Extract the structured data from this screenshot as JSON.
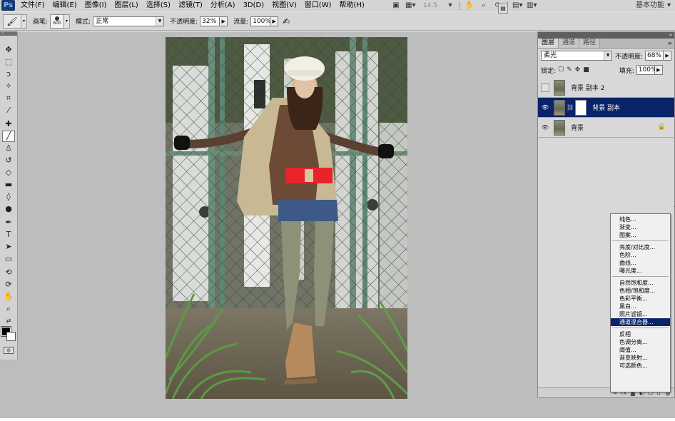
{
  "app": {
    "logo": "Ps",
    "workspace": "基本功能"
  },
  "menus": [
    {
      "label": "文件(F)"
    },
    {
      "label": "编辑(E)"
    },
    {
      "label": "图像(I)"
    },
    {
      "label": "图层(L)"
    },
    {
      "label": "选择(S)"
    },
    {
      "label": "滤镜(T)"
    },
    {
      "label": "分析(A)"
    },
    {
      "label": "3D(D)"
    },
    {
      "label": "视图(V)"
    },
    {
      "label": "窗口(W)"
    },
    {
      "label": "帮助(H)"
    }
  ],
  "menubar_right": {
    "zoom": "14.5"
  },
  "options": {
    "brush_label": "画笔:",
    "brush_size": "600",
    "mode_label": "模式:",
    "mode_value": "正常",
    "opacity_label": "不透明度:",
    "opacity_value": "32%",
    "flow_label": "流量:",
    "flow_value": "100%"
  },
  "layers_panel": {
    "tabs": [
      {
        "label": "图层"
      },
      {
        "label": "通道"
      },
      {
        "label": "路径"
      }
    ],
    "blend_mode": "柔光",
    "opacity_label": "不透明度:",
    "opacity_value": "68%",
    "lock_label": "锁定:",
    "fill_label": "填充:",
    "fill_value": "100%",
    "layers": [
      {
        "name": "背景 副本 2",
        "visible": false,
        "selected": false
      },
      {
        "name": "背景 副本",
        "visible": true,
        "selected": true
      },
      {
        "name": "背景",
        "visible": true,
        "selected": false
      }
    ]
  },
  "adjust_menu": {
    "group1": [
      "纯色...",
      "渐变...",
      "图案..."
    ],
    "group2": [
      "亮度/对比度...",
      "色阶...",
      "曲线...",
      "曝光度..."
    ],
    "group3": [
      "自然饱和度...",
      "色相/饱和度...",
      "色彩平衡...",
      "黑白...",
      "照片滤镜...",
      "通道混合器..."
    ],
    "group4": [
      "反相",
      "色调分离...",
      "阈值...",
      "渐变映射...",
      "可选颜色..."
    ],
    "highlighted": "通道混合器..."
  },
  "colors": {
    "workspace_bg": "#bdbdbd",
    "selection": "#0a246a",
    "foreground": "#000000",
    "background": "#ffffff",
    "belt_red": "#e8242a"
  }
}
